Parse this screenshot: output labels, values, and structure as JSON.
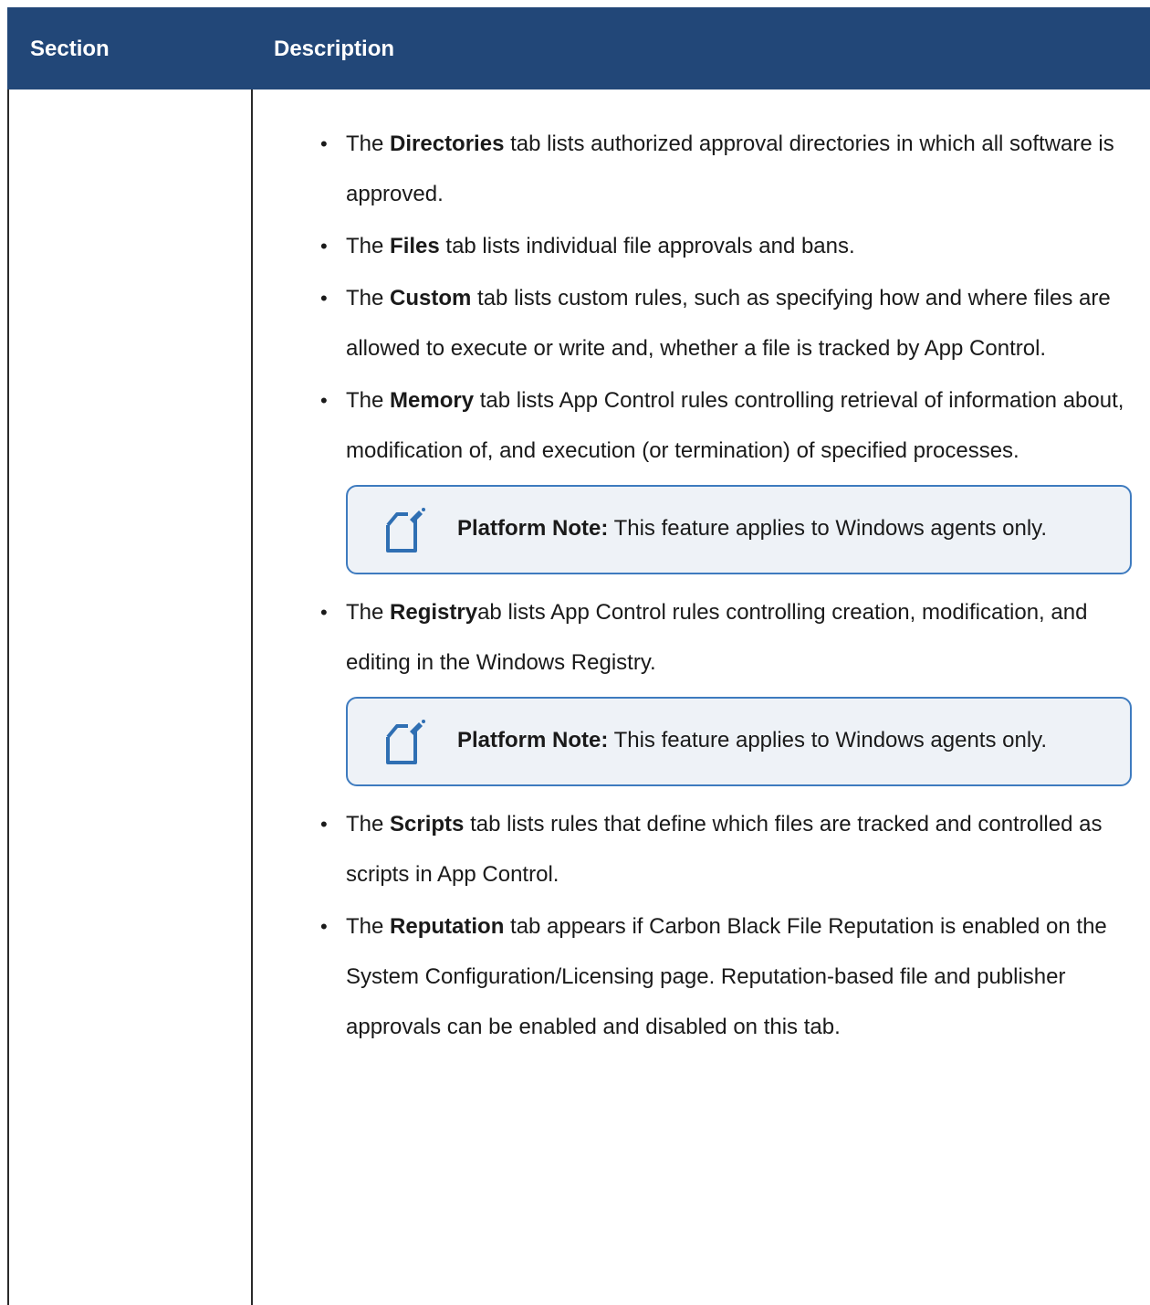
{
  "table": {
    "header": {
      "section": "Section",
      "description": "Description"
    }
  },
  "bullets": [
    {
      "pre": "The ",
      "bold": "Directories",
      "post": " tab lists authorized approval directories in which all software is approved."
    },
    {
      "pre": "The ",
      "bold": "Files",
      "post": " tab lists individual file approvals and bans."
    },
    {
      "pre": "The ",
      "bold": "Custom",
      "post": " tab lists custom rules, such as specifying how and where files are allowed to execute or write and, whether a file is tracked by App Control."
    },
    {
      "pre": "The ",
      "bold": "Memory",
      "post": " tab lists App Control rules controlling retrieval of information about, modification of, and execution (or termination) of specified processes."
    },
    {
      "pre": "The ",
      "bold": "Registry",
      "post": "ab lists App Control rules controlling creation, modification, and editing in the Windows Registry."
    },
    {
      "pre": "The ",
      "bold": "Scripts",
      "post": " tab lists rules that define which files are tracked and controlled as scripts in App Control."
    },
    {
      "pre": "The ",
      "bold": "Reputation",
      "post": " tab appears if Carbon Black File Reputation is enabled on the System Configuration/Licensing page. Reputation-based file and publisher approvals can be enabled and disabled on this tab."
    }
  ],
  "notes": [
    {
      "label": "Platform Note:",
      "text": " This feature applies to Windows agents only.",
      "icon": "note-edit-icon"
    },
    {
      "label": "Platform Note:",
      "text": " This feature applies to Windows agents only.",
      "icon": "note-edit-icon"
    }
  ],
  "colors": {
    "header_bg": "#224778",
    "note_border": "#3e7bbf",
    "note_bg": "#eef2f7"
  }
}
